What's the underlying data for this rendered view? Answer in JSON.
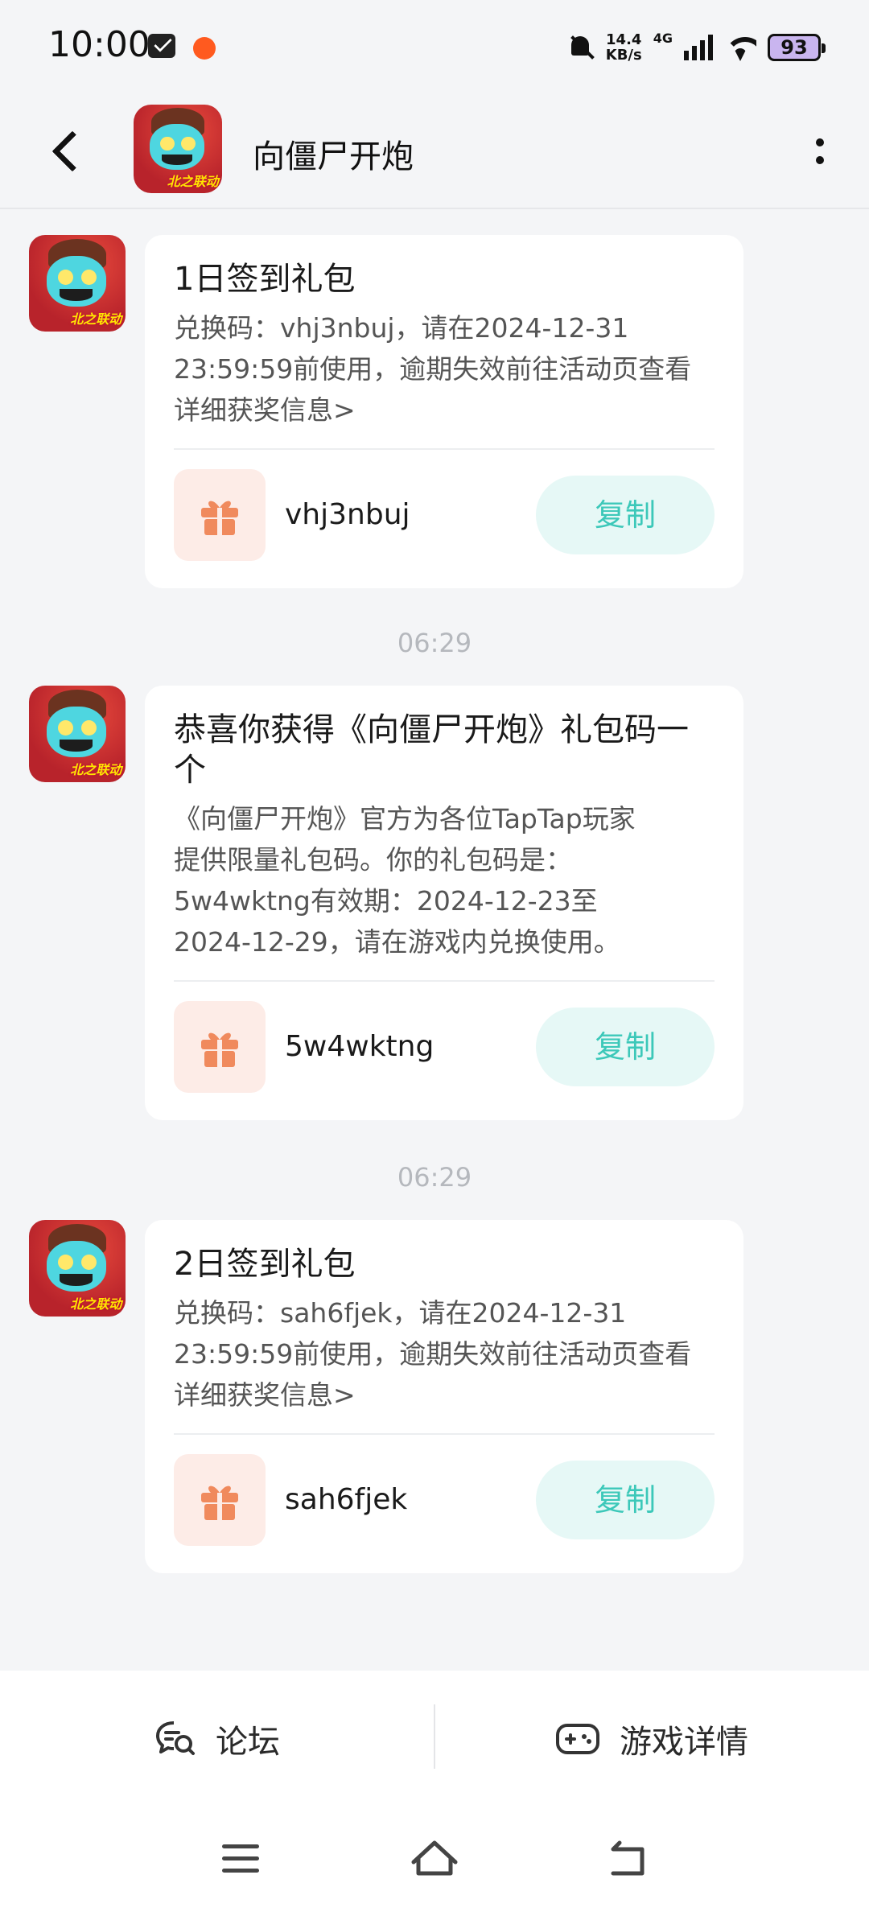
{
  "status_bar": {
    "time": "10:00",
    "net_speed_value": "14.4",
    "net_speed_unit": "KB/s",
    "network_type": "4G",
    "battery": "93"
  },
  "header": {
    "title": "向僵尸开炮",
    "logo_text": "北之联动"
  },
  "messages": [
    {
      "title": "1日签到礼包",
      "body": "兑换码：vhj3nbuj，请在2024-12-31 23:59:59前使用，逾期失效前往活动页查看详细获奖信息>",
      "code": "vhj3nbuj",
      "copy_label": "复制"
    },
    {
      "time": "06:29",
      "title": "恭喜你获得《向僵尸开炮》礼包码一个",
      "body": "《向僵尸开炮》官方为各位TapTap玩家提供限量礼包码。你的礼包码是：5w4wktng有效期：2024-12-23至2024-12-29，请在游戏内兑换使用。",
      "code": "5w4wktng",
      "copy_label": "复制"
    },
    {
      "time": "06:29",
      "title": "2日签到礼包",
      "body": "兑换码：sah6fjek，请在2024-12-31 23:59:59前使用，逾期失效前往活动页查看详细获奖信息>",
      "code": "sah6fjek",
      "copy_label": "复制"
    }
  ],
  "bottom_bar": {
    "forum_label": "论坛",
    "details_label": "游戏详情"
  },
  "icons": {
    "back": "chevron-left-icon",
    "more": "more-vertical-icon",
    "gift": "gift-icon",
    "forum": "chat-search-icon",
    "details": "gamepad-icon"
  },
  "colors": {
    "accent_teal": "#3cc8b9",
    "copy_bg": "#e6f8f6",
    "gift_orange": "#f08a5d",
    "gift_bg": "#fdece7",
    "page_bg": "#f4f5f7"
  }
}
